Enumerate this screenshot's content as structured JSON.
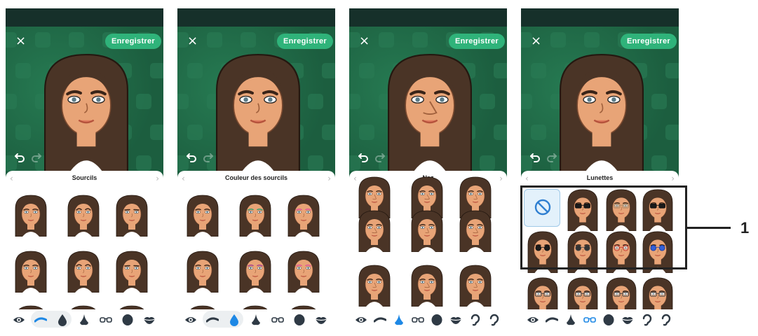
{
  "screens": [
    {
      "close_label": "×",
      "save_label": "Enregistrer",
      "panel_title": "Sourcils",
      "active_tool": "eyebrow",
      "variant": "brows"
    },
    {
      "close_label": "×",
      "save_label": "Enregistrer",
      "panel_title": "Couleur des sourcils",
      "active_tool": "eyebrow-color",
      "variant": "browcolor"
    },
    {
      "close_label": "×",
      "save_label": "Enregistrer",
      "panel_title": "Nez",
      "active_tool": "nose",
      "variant": "nose"
    },
    {
      "close_label": "×",
      "save_label": "Enregistrer",
      "panel_title": "Lunettes",
      "active_tool": "glasses",
      "variant": "glasses"
    }
  ],
  "callout": {
    "number": "1"
  },
  "colors": {
    "save_button": "#2fb37a",
    "preview_bg": "#1f6a47",
    "hair": "#4a3426",
    "skin": "#e8a477",
    "active_tool": "#1e88e5",
    "inactive_tool": "#2f3a45"
  },
  "icons": [
    "close-icon",
    "undo-icon",
    "redo-icon",
    "eye-icon",
    "eyebrow-icon",
    "drop-icon",
    "nose-icon",
    "glasses-icon",
    "face-shape-icon",
    "lips-icon",
    "ear-icon",
    "no-glasses-icon"
  ],
  "glasses_options": [
    "none",
    "black-wayfarer",
    "tan-aviator",
    "black-square",
    "black-round-shades",
    "grey-round",
    "red-round",
    "blue-mirrored"
  ]
}
